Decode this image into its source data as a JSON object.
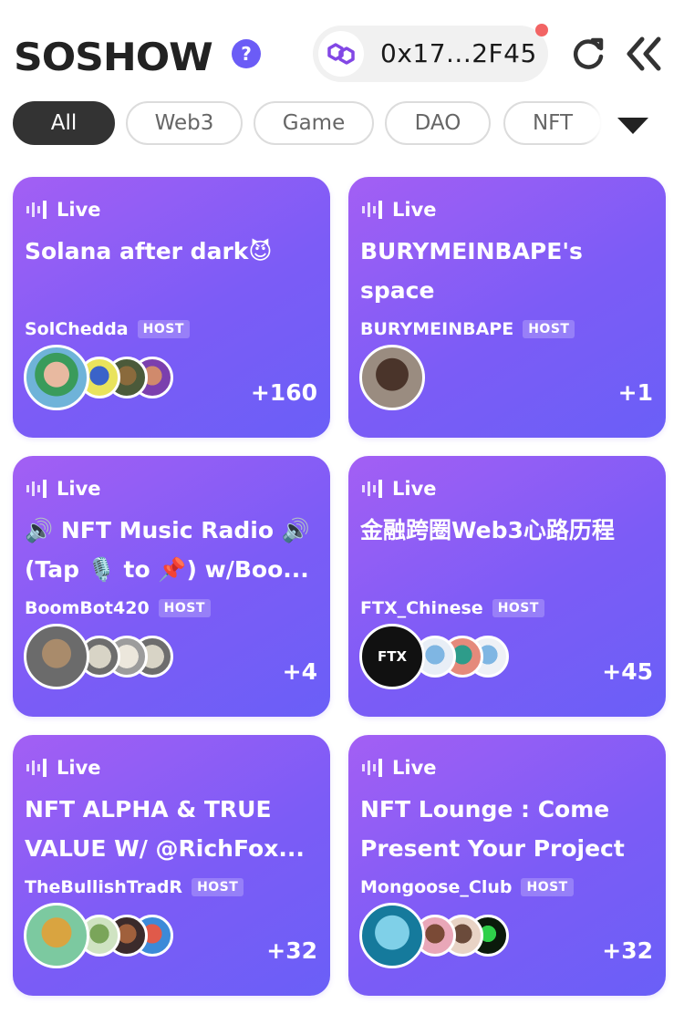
{
  "app": {
    "logo": "SOSHOW",
    "help_label": "?"
  },
  "wallet": {
    "address": "0x17...2F45",
    "network_icon": "polygon-icon",
    "notification": true
  },
  "tabs": [
    {
      "label": "All",
      "active": true
    },
    {
      "label": "Web3",
      "active": false
    },
    {
      "label": "Game",
      "active": false
    },
    {
      "label": "DAO",
      "active": false
    },
    {
      "label": "NFT",
      "active": false
    }
  ],
  "cards": [
    {
      "status": "Live",
      "title": "Solana after dark😈",
      "host": "SolChedda",
      "host_badge": "HOST",
      "listener_count": "+160"
    },
    {
      "status": "Live",
      "title": "BURYMEINBAPE's space",
      "host": "BURYMEINBAPE",
      "host_badge": "HOST",
      "listener_count": "+1"
    },
    {
      "status": "Live",
      "title": "🔊  NFT Music Radio 🔊 (Tap 🎙️ to 📌)  w/Boo...",
      "host": "BoomBot420",
      "host_badge": "HOST",
      "listener_count": "+4"
    },
    {
      "status": "Live",
      "title": "金融跨圈Web3心路历程",
      "host": "FTX_Chinese",
      "host_badge": "HOST",
      "listener_count": "+45",
      "host_avatar_text": "FTX"
    },
    {
      "status": "Live",
      "title": "NFT ALPHA & TRUE VALUE W/ @RichFox...",
      "host": "TheBullishTradR",
      "host_badge": "HOST",
      "listener_count": "+32"
    },
    {
      "status": "Live",
      "title": "NFT Lounge : Come Present Your Project ...",
      "host": "Mongoose_Club",
      "host_badge": "HOST",
      "listener_count": "+32"
    }
  ],
  "colors": {
    "accent": "#6b5cf6",
    "card_start": "#a35ff4",
    "card_end": "#6a5ff7",
    "notification": "#f26464"
  }
}
